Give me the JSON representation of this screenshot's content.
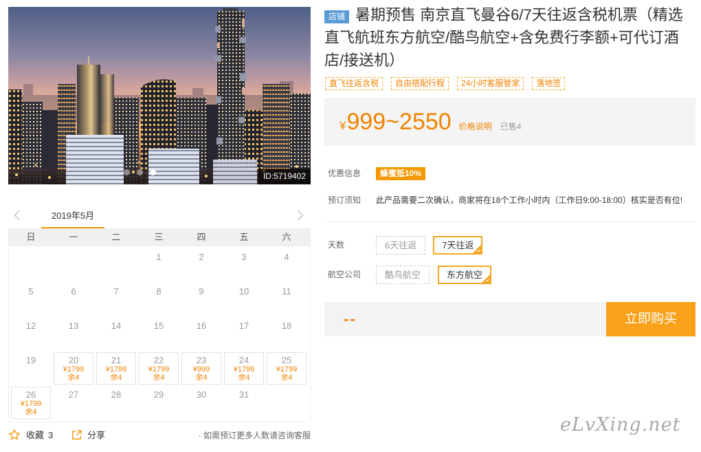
{
  "gallery": {
    "image_id": "ID:5719402",
    "slide_count": 3,
    "active_slide": 3
  },
  "calendar": {
    "month_label": "2019年5月",
    "weekdays": [
      "日",
      "一",
      "二",
      "三",
      "四",
      "五",
      "六"
    ],
    "weeks": [
      [
        null,
        null,
        null,
        {
          "day": "1"
        },
        {
          "day": "2"
        },
        {
          "day": "3"
        },
        {
          "day": "4"
        }
      ],
      [
        {
          "day": "5"
        },
        {
          "day": "6"
        },
        {
          "day": "7"
        },
        {
          "day": "8"
        },
        {
          "day": "9"
        },
        {
          "day": "10"
        },
        {
          "day": "11"
        }
      ],
      [
        {
          "day": "12"
        },
        {
          "day": "13"
        },
        {
          "day": "14"
        },
        {
          "day": "15"
        },
        {
          "day": "16"
        },
        {
          "day": "17"
        },
        {
          "day": "18"
        }
      ],
      [
        {
          "day": "19"
        },
        {
          "day": "20",
          "price": "¥1799",
          "stock": "余4"
        },
        {
          "day": "21",
          "price": "¥1799",
          "stock": "余4"
        },
        {
          "day": "22",
          "price": "¥1799",
          "stock": "余4"
        },
        {
          "day": "23",
          "price": "¥999",
          "stock": "余4"
        },
        {
          "day": "24",
          "price": "¥1799",
          "stock": "余4"
        },
        {
          "day": "25",
          "price": "¥1799",
          "stock": "余4"
        }
      ],
      [
        {
          "day": "26",
          "price": "¥1799",
          "stock": "余4"
        },
        {
          "day": "27"
        },
        {
          "day": "28"
        },
        {
          "day": "29"
        },
        {
          "day": "30"
        },
        {
          "day": "31"
        },
        null
      ]
    ]
  },
  "actions": {
    "favorite_label": "收藏",
    "favorite_count": "3",
    "share_label": "分享",
    "note": "· 如需预订更多人数请咨询客服"
  },
  "product": {
    "shop_badge": "店铺",
    "title": "暑期预售 南京直飞曼谷6/7天往返含税机票（精选直飞航班东方航空/酷鸟航空+含免费行李额+可代订酒店/接送机）",
    "tags": [
      "直飞往返含税",
      "自由搭配行程",
      "24小时客服管家",
      "落地签"
    ]
  },
  "price": {
    "currency": "¥",
    "range": "999~2550",
    "note": "价格说明",
    "sold": "已售4"
  },
  "promo": {
    "label": "优惠信息",
    "badge": "蜂蜜抵10%"
  },
  "notice": {
    "label": "预订须知",
    "text": "此产品需要二次确认，商家将在18个工作小时内（工作日9:00-18:00）核实是否有位!"
  },
  "options": {
    "days": {
      "label": "天数",
      "choices": [
        "6天往返",
        "7天往返"
      ],
      "selected_index": 1
    },
    "airline": {
      "label": "航空公司",
      "choices": [
        "酷鸟航空",
        "东方航空"
      ],
      "selected_index": 1
    }
  },
  "purchase": {
    "total": "--",
    "buy_label": "立即购买"
  },
  "watermark": "eLvXing.net",
  "icons": {
    "favorite": "star-icon",
    "share": "share-icon",
    "prev_month": "chevron-left-icon",
    "next_month": "chevron-right-icon",
    "selected_option": "check-icon"
  },
  "colors": {
    "accent": "#f39800",
    "price": "#f08300",
    "shop_badge": "#5b9bd5",
    "buy_button": "#f9a11b"
  }
}
